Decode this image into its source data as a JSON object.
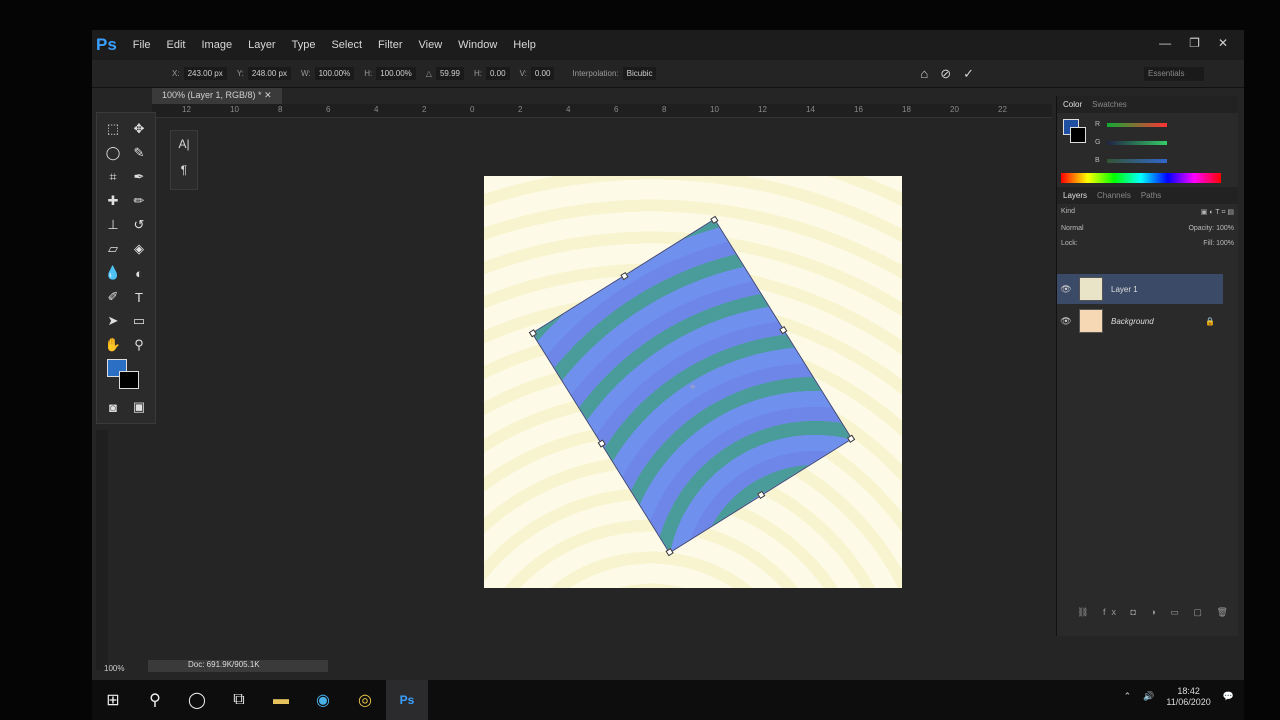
{
  "app": {
    "logo": "Ps",
    "menu": [
      "File",
      "Edit",
      "Image",
      "Layer",
      "Type",
      "Select",
      "Filter",
      "View",
      "Window",
      "Help"
    ],
    "window_controls": [
      "—",
      "❐",
      "✕"
    ]
  },
  "options": {
    "x_label": "X:",
    "x_value": "243.00 px",
    "y_label": "Y:",
    "y_value": "248.00 px",
    "w_label": "W:",
    "w_value": "100.00%",
    "h_label": "H:",
    "h_value": "100.00%",
    "angle_value": "59.99",
    "hskew_label": "H:",
    "hskew_value": "0.00",
    "vskew_label": "V:",
    "vskew_value": "0.00",
    "interp_label": "Interpolation:",
    "interp_value": "Bicubic",
    "workspace": "Essentials"
  },
  "document": {
    "tab_title": "100% (Layer 1, RGB/8) *",
    "ruler_numbers": [
      "12",
      "10",
      "8",
      "6",
      "4",
      "2",
      "0",
      "2",
      "4",
      "6",
      "8",
      "10",
      "12",
      "14",
      "16",
      "18",
      "20",
      "22"
    ],
    "zoom": "100%",
    "doc_info": "Doc: 691.9K/905.1K"
  },
  "mini_panel": [
    "A|",
    "¶"
  ],
  "color_panel": {
    "tabs": [
      "Color",
      "Swatches"
    ],
    "channels": [
      "R",
      "G",
      "B"
    ],
    "fg_color": "#1f4fa0",
    "bg_color": "#000000"
  },
  "layers_panel": {
    "tabs": [
      "Layers",
      "Channels",
      "Paths"
    ],
    "kind": "Kind",
    "blend_mode": "Normal",
    "opacity_label": "Opacity:",
    "opacity_value": "100%",
    "lock_label": "Lock:",
    "fill_label": "Fill:",
    "fill_value": "100%",
    "layers": [
      {
        "name": "Layer 1",
        "selected": true
      },
      {
        "name": "Background",
        "selected": false
      }
    ]
  },
  "taskbar": {
    "time": "18:42",
    "date": "11/06/2020"
  },
  "colors": {
    "accent": "#3aa0ff",
    "foreground": "#2b6fc4",
    "layer_selected": "#3b4a66"
  }
}
